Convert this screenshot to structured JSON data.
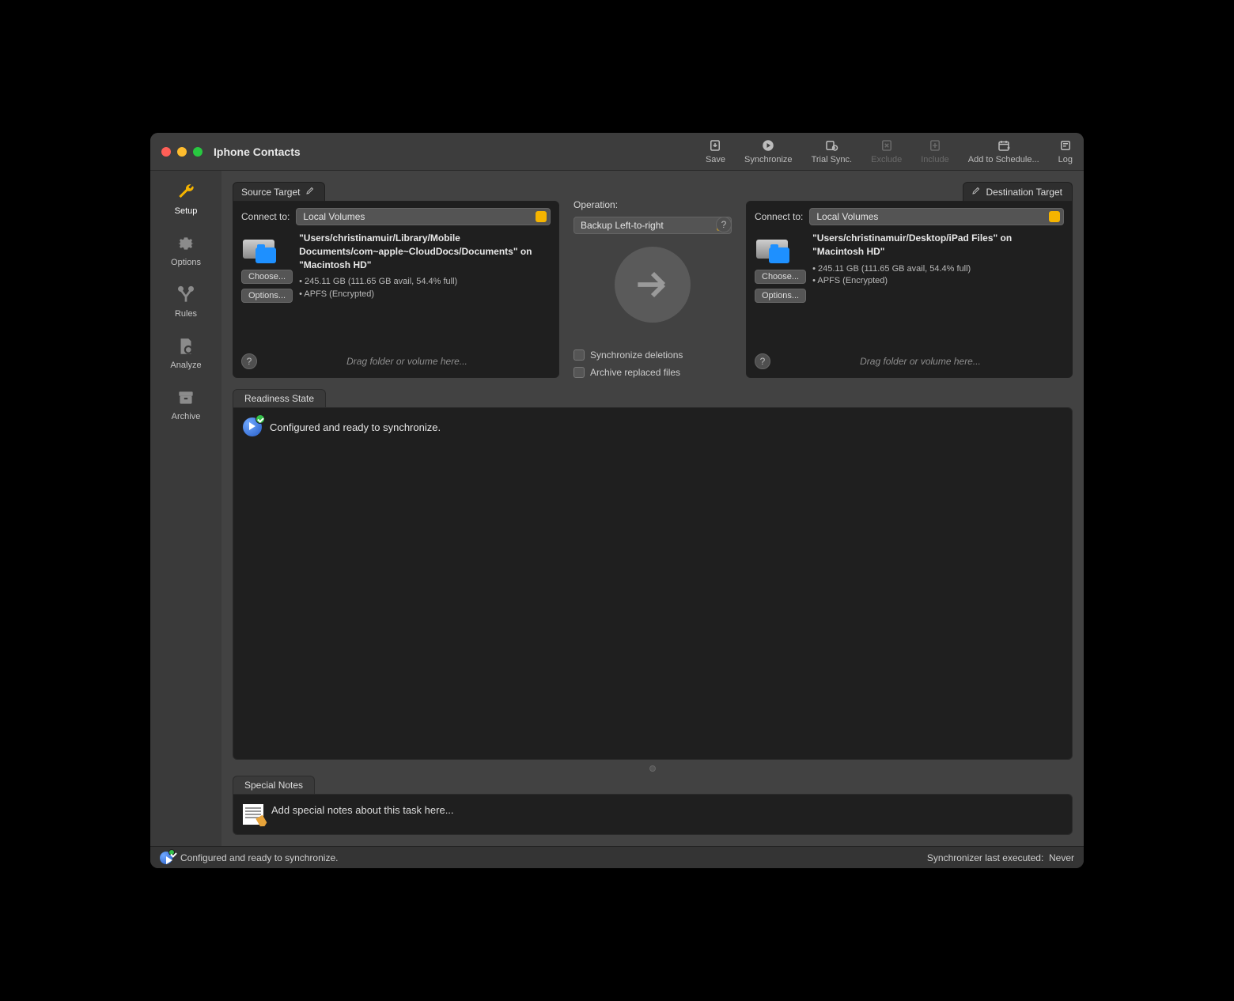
{
  "window": {
    "title": "Iphone Contacts"
  },
  "toolbar": {
    "save": "Save",
    "synchronize": "Synchronize",
    "trial_sync": "Trial Sync.",
    "exclude": "Exclude",
    "include": "Include",
    "add_schedule": "Add to Schedule...",
    "log": "Log"
  },
  "sidebar": {
    "items": [
      {
        "label": "Setup"
      },
      {
        "label": "Options"
      },
      {
        "label": "Rules"
      },
      {
        "label": "Analyze"
      },
      {
        "label": "Archive"
      }
    ]
  },
  "source": {
    "tab_label": "Source Target",
    "connect_label": "Connect to:",
    "connect_value": "Local Volumes",
    "path": "\"Users/christinamuir/Library/Mobile Documents/com~apple~CloudDocs/Documents\" on \"Macintosh HD\"",
    "stats": "• 245.11 GB (111.65 GB avail, 54.4% full)",
    "fs": "• APFS (Encrypted)",
    "choose": "Choose...",
    "options": "Options...",
    "drop_hint": "Drag folder or volume here..."
  },
  "destination": {
    "tab_label": "Destination Target",
    "connect_label": "Connect to:",
    "connect_value": "Local Volumes",
    "path": "\"Users/christinamuir/Desktop/iPad Files\" on \"Macintosh HD\"",
    "stats": "• 245.11 GB (111.65 GB avail, 54.4% full)",
    "fs": "• APFS (Encrypted)",
    "choose": "Choose...",
    "options": "Options...",
    "drop_hint": "Drag folder or volume here..."
  },
  "operation": {
    "label": "Operation:",
    "value": "Backup Left-to-right",
    "sync_deletions": "Synchronize deletions",
    "archive_replaced": "Archive replaced files"
  },
  "readiness": {
    "tab_label": "Readiness State",
    "message": "Configured and ready to synchronize."
  },
  "notes": {
    "tab_label": "Special Notes",
    "placeholder": "Add special notes about this task here..."
  },
  "statusbar": {
    "message": "Configured and ready to synchronize.",
    "last_exec_label": "Synchronizer last executed:",
    "last_exec_value": "Never"
  }
}
